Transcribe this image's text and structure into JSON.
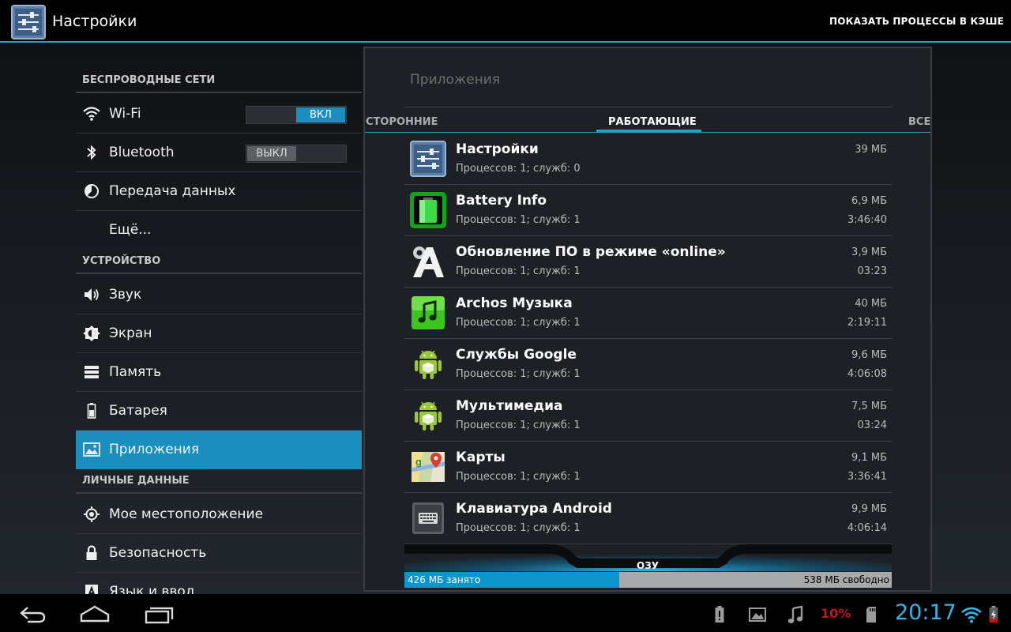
{
  "actionbar": {
    "title": "Настройки",
    "action_label": "ПОКАЗАТЬ ПРОЦЕССЫ В КЭШЕ",
    "icon": "settings-sliders-icon"
  },
  "sidebar": {
    "sections": [
      {
        "header": "БЕСПРОВОДНЫЕ СЕТИ"
      },
      {
        "header": "УСТРОЙСТВО"
      },
      {
        "header": "ЛИЧНЫЕ ДАННЫЕ"
      }
    ],
    "items": [
      {
        "label": "Wi-Fi",
        "icon": "wifi-icon",
        "toggle": "ВКЛ"
      },
      {
        "label": "Bluetooth",
        "icon": "bluetooth-icon",
        "toggle": "ВЫКЛ"
      },
      {
        "label": "Передача данных",
        "icon": "data-usage-icon"
      },
      {
        "label": "Ещё...",
        "icon": ""
      },
      {
        "label": "Звук",
        "icon": "speaker-icon"
      },
      {
        "label": "Экран",
        "icon": "display-icon"
      },
      {
        "label": "Память",
        "icon": "storage-icon"
      },
      {
        "label": "Батарея",
        "icon": "battery-icon"
      },
      {
        "label": "Приложения",
        "icon": "apps-icon",
        "active": true
      },
      {
        "label": "Мое местоположение",
        "icon": "location-icon"
      },
      {
        "label": "Безопасность",
        "icon": "lock-icon"
      },
      {
        "label": "Язык и ввод",
        "icon": "language-icon"
      }
    ]
  },
  "panel": {
    "title": "Приложения",
    "tabs": [
      {
        "label": "СТОРОННИЕ"
      },
      {
        "label": "РАБОТАЮЩИЕ",
        "selected": true
      },
      {
        "label": "ВСЕ"
      }
    ],
    "apps": [
      {
        "name": "Настройки",
        "procs": "Процессов: 1; служб: 0",
        "mem": "39 МБ",
        "time": "",
        "icon": "settings-app-icon"
      },
      {
        "name": "Battery Info",
        "procs": "Процессов: 1; служб: 1",
        "mem": "6,9 МБ",
        "time": "3:46:40",
        "icon": "battery-info-icon"
      },
      {
        "name": "Обновление ПО в режиме «online»",
        "procs": "Процессов: 1; служб: 1",
        "mem": "3,9 МБ",
        "time": "03:23",
        "icon": "archos-update-icon"
      },
      {
        "name": "Archos Музыка",
        "procs": "Процессов: 1; служб: 1",
        "mem": "40 МБ",
        "time": "2:19:11",
        "icon": "music-note-icon"
      },
      {
        "name": "Службы Google",
        "procs": "Процессов: 1; служб: 1",
        "mem": "9,6 МБ",
        "time": "4:06:08",
        "icon": "android-robot-icon"
      },
      {
        "name": "Мультимедиа",
        "procs": "Процессов: 1; служб: 1",
        "mem": "7,5 МБ",
        "time": "03:24",
        "icon": "android-robot-icon"
      },
      {
        "name": "Карты",
        "procs": "Процессов: 1; служб: 1",
        "mem": "9,1 МБ",
        "time": "3:36:41",
        "icon": "maps-icon"
      },
      {
        "name": "Клавиатура Android",
        "procs": "Процессов: 1; служб: 1",
        "mem": "9,9 МБ",
        "time": "4:06:14",
        "icon": "keyboard-icon"
      }
    ],
    "ram": {
      "label": "ОЗУ",
      "used": "426 МБ занято",
      "free": "538 МБ свободно",
      "used_fraction": 0.44
    }
  },
  "sysbar": {
    "battery_pct": "10%",
    "time": "20:17",
    "accent": "#33b5e5"
  }
}
